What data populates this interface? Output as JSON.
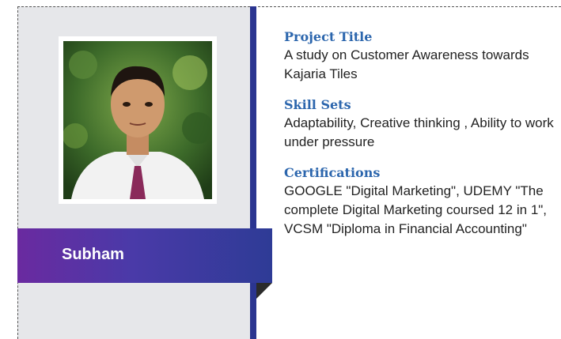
{
  "profile": {
    "name": "Subham"
  },
  "sections": [
    {
      "heading": "Project Title",
      "text": "A study on Customer Awareness towards Kajaria Tiles"
    },
    {
      "heading": "Skill Sets",
      "text": "Adaptability, Creative thinking , Ability to work under pressure"
    },
    {
      "heading": "Certifications",
      "text": "GOOGLE \"Digital Marketing\", UDEMY \"The complete Digital Marketing coursed 12 in 1\", VCSM \"Diploma in Financial Accounting\""
    }
  ],
  "colors": {
    "panel_bg": "#e6e7ea",
    "divider": "#2b3590",
    "heading": "#2c66ad",
    "banner_start": "#6a2aa0",
    "banner_end": "#2e3b96"
  }
}
